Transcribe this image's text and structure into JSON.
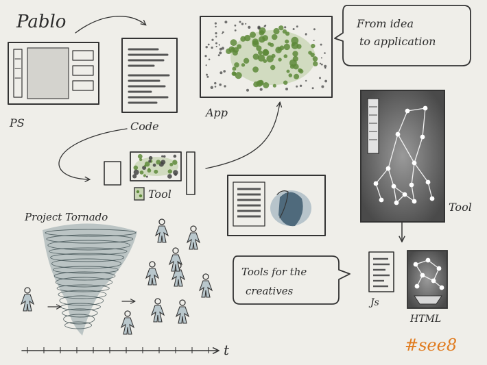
{
  "title": "Pablo",
  "labels": {
    "ps": "PS",
    "code": "Code",
    "app": "App",
    "tool_small": "Tool",
    "tool_large": "Tool",
    "tornado": "Project Tornado",
    "js": "Js",
    "html": "HTML",
    "time_axis": "t"
  },
  "bubbles": {
    "idea_line1": "From idea",
    "idea_line2": "to application",
    "creatives_line1": "Tools for the",
    "creatives_line2": "creatives"
  },
  "hashtag": "#see8",
  "colors": {
    "ink": "#333333",
    "green": "#5e8a3a",
    "grey_fill": "#5a5a5a",
    "tornado": "#8fa3a6",
    "face": "#3d5a6e",
    "hashtag": "#e07b1f"
  }
}
